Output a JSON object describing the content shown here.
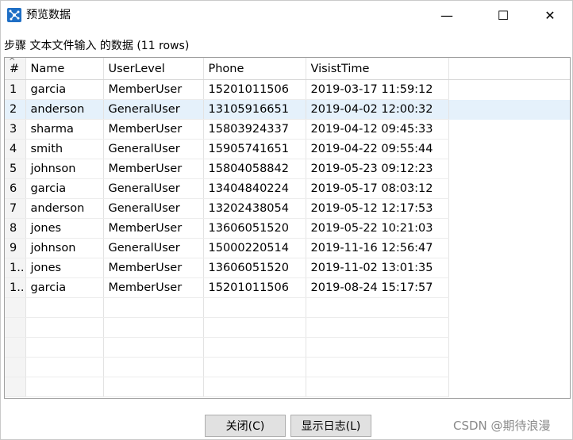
{
  "window": {
    "title": "预览数据",
    "minimize_glyph": "—",
    "maximize_glyph": "☐",
    "close_glyph": "✕"
  },
  "subtitle": "步骤 文本文件输入 的数据  (11 rows)",
  "grid": {
    "index_header": "#",
    "columns": [
      "Name",
      "UserLevel",
      "Phone",
      "VisistTime"
    ],
    "selected_row": 2,
    "rows": [
      {
        "idx": "1",
        "cells": [
          "garcia",
          "MemberUser",
          "15201011506",
          "2019-03-17 11:59:12"
        ]
      },
      {
        "idx": "2",
        "cells": [
          "anderson",
          "GeneralUser",
          "13105916651",
          "2019-04-02 12:00:32"
        ]
      },
      {
        "idx": "3",
        "cells": [
          "sharma",
          "MemberUser",
          "15803924337",
          "2019-04-12 09:45:33"
        ]
      },
      {
        "idx": "4",
        "cells": [
          "smith",
          "GeneralUser",
          "15905741651",
          "2019-04-22 09:55:44"
        ]
      },
      {
        "idx": "5",
        "cells": [
          "johnson",
          "MemberUser",
          "15804058842",
          "2019-05-23 09:12:23"
        ]
      },
      {
        "idx": "6",
        "cells": [
          "garcia",
          "GeneralUser",
          "13404840224",
          "2019-05-17 08:03:12"
        ]
      },
      {
        "idx": "7",
        "cells": [
          "anderson",
          "GeneralUser",
          "13202438054",
          "2019-05-12 12:17:53"
        ]
      },
      {
        "idx": "8",
        "cells": [
          "jones",
          "MemberUser",
          "13606051520",
          "2019-05-22 10:21:03"
        ]
      },
      {
        "idx": "9",
        "cells": [
          "johnson",
          "GeneralUser",
          "15000220514",
          "2019-11-16 12:56:47"
        ]
      },
      {
        "idx": "1..",
        "cells": [
          "jones",
          "MemberUser",
          "13606051520",
          "2019-11-02 13:01:35"
        ]
      },
      {
        "idx": "1..",
        "cells": [
          "garcia",
          "MemberUser",
          "15201011506",
          "2019-08-24 15:17:57"
        ]
      }
    ]
  },
  "buttons": {
    "close": "关闭(C)",
    "show_log": "显示日志(L)"
  },
  "watermark": "CSDN @期待浪漫",
  "colors": {
    "selected_row": "#e5f1fb",
    "app_icon": "#1f6fc5"
  }
}
